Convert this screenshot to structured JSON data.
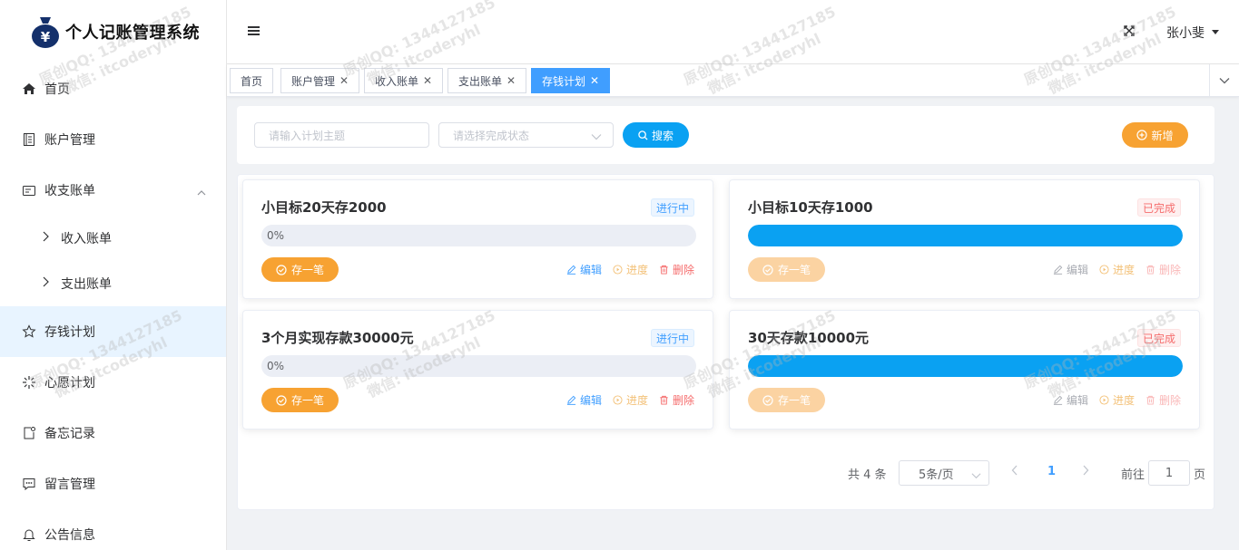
{
  "app": {
    "title": "个人记账管理系统"
  },
  "sidebar": {
    "items": [
      {
        "label": "首页",
        "icon": "home-icon"
      },
      {
        "label": "账户管理",
        "icon": "book-icon"
      },
      {
        "label": "收支账单",
        "icon": "bill-icon"
      },
      {
        "label": "收入账单",
        "icon": "chevron-right-icon"
      },
      {
        "label": "支出账单",
        "icon": "chevron-right-icon"
      },
      {
        "label": "存钱计划",
        "icon": "star-icon"
      },
      {
        "label": "心愿计划",
        "icon": "sparkle-icon"
      },
      {
        "label": "备忘记录",
        "icon": "memo-icon"
      },
      {
        "label": "留言管理",
        "icon": "chat-icon"
      },
      {
        "label": "公告信息",
        "icon": "bell-icon"
      }
    ]
  },
  "header": {
    "user": "张小斐"
  },
  "tabs": [
    {
      "label": "首页"
    },
    {
      "label": "账户管理"
    },
    {
      "label": "收入账单"
    },
    {
      "label": "支出账单"
    },
    {
      "label": "存钱计划"
    }
  ],
  "search": {
    "topic_placeholder": "请输入计划主题",
    "status_placeholder": "请选择完成状态",
    "search_label": "搜索",
    "add_label": "新增"
  },
  "plans": [
    {
      "title": "小目标20天存2000",
      "status": "进行中",
      "progress": 0,
      "progress_text": "0%",
      "save": "存一笔",
      "edit": "编辑",
      "progress_action": "进度",
      "delete": "删除"
    },
    {
      "title": "小目标10天存1000",
      "status": "已完成",
      "progress": 100,
      "progress_text": "",
      "save": "存一笔",
      "edit": "编辑",
      "progress_action": "进度",
      "delete": "删除"
    },
    {
      "title": "3个月实现存款30000元",
      "status": "进行中",
      "progress": 0,
      "progress_text": "0%",
      "save": "存一笔",
      "edit": "编辑",
      "progress_action": "进度",
      "delete": "删除"
    },
    {
      "title": "30天存款10000元",
      "status": "已完成",
      "progress": 100,
      "progress_text": "",
      "save": "存一笔",
      "edit": "编辑",
      "progress_action": "进度",
      "delete": "删除"
    }
  ],
  "pagination": {
    "total": "共 4 条",
    "page_size": "5条/页",
    "current": "1",
    "goto_label": "前往",
    "goto_value": "1",
    "goto_suffix": "页"
  },
  "watermark": {
    "line1": "原创QQ: 1344127185",
    "line2": "微信: itcoderyhl"
  },
  "colors": {
    "primary": "#0aa1f2",
    "warning": "#f7a232",
    "danger": "#f56c6c"
  }
}
